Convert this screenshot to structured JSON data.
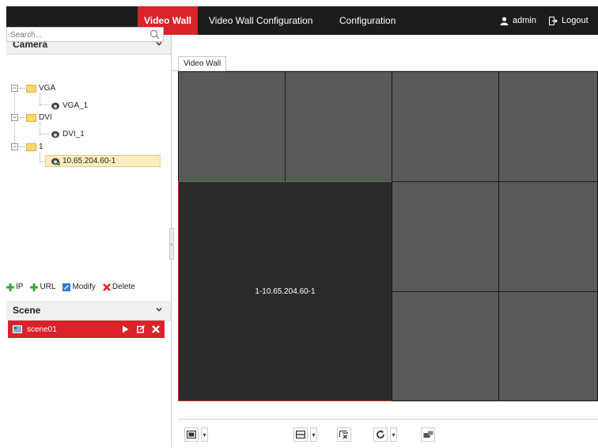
{
  "header": {
    "tabs": [
      {
        "label": "Video Wall",
        "active": true
      },
      {
        "label": "Video Wall Configuration",
        "active": false
      },
      {
        "label": "Configuration",
        "active": false
      }
    ],
    "user": "admin",
    "logout_label": "Logout"
  },
  "camera_panel": {
    "title": "Camera",
    "search_placeholder": "Search...",
    "tree": [
      {
        "label": "VGA",
        "type": "folder",
        "children": [
          {
            "label": "VGA_1",
            "type": "camera"
          }
        ]
      },
      {
        "label": "DVI",
        "type": "folder",
        "children": [
          {
            "label": "DVI_1",
            "type": "camera"
          }
        ]
      },
      {
        "label": "1",
        "type": "folder",
        "children": [
          {
            "label": "10.65.204.60-1",
            "type": "camera",
            "selected": true
          }
        ]
      }
    ],
    "actions": {
      "ip": "IP",
      "url": "URL",
      "modify": "Modify",
      "delete": "Delete"
    }
  },
  "scene_panel": {
    "title": "Scene",
    "scenes": [
      {
        "label": "scene01",
        "selected": true
      }
    ]
  },
  "main": {
    "tab_label": "Video Wall",
    "big_window_label": "1-10.65.204.60-1"
  },
  "colors": {
    "accent": "#d9222a",
    "topbar": "#1c1c1c",
    "wall_cell": "#595959",
    "active_window": "#2b2b2b"
  }
}
